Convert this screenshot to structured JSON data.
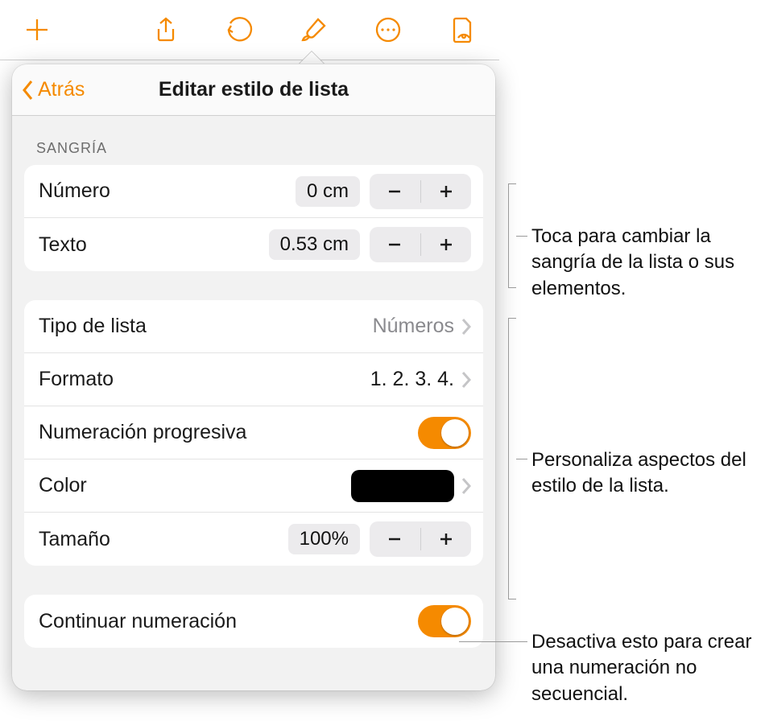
{
  "colors": {
    "accent": "#f58a00",
    "swatch": "#000000"
  },
  "header": {
    "back_label": "Atrás",
    "title": "Editar estilo de lista"
  },
  "section_indent_header": "SANGRÍA",
  "indent": {
    "number_label": "Número",
    "number_value": "0 cm",
    "text_label": "Texto",
    "text_value": "0.53 cm"
  },
  "style": {
    "list_type_label": "Tipo de lista",
    "list_type_value": "Números",
    "format_label": "Formato",
    "format_value": "1. 2. 3. 4.",
    "progressive_label": "Numeración progresiva",
    "progressive_on": true,
    "color_label": "Color",
    "size_label": "Tamaño",
    "size_value": "100%"
  },
  "continue": {
    "label": "Continuar numeración",
    "on": true
  },
  "callouts": {
    "indent": "Toca para cambiar la sangría de la lista o sus elementos.",
    "style": "Personaliza aspectos del estilo de la lista.",
    "continue": "Desactiva esto para crear una numeración no secuencial."
  }
}
